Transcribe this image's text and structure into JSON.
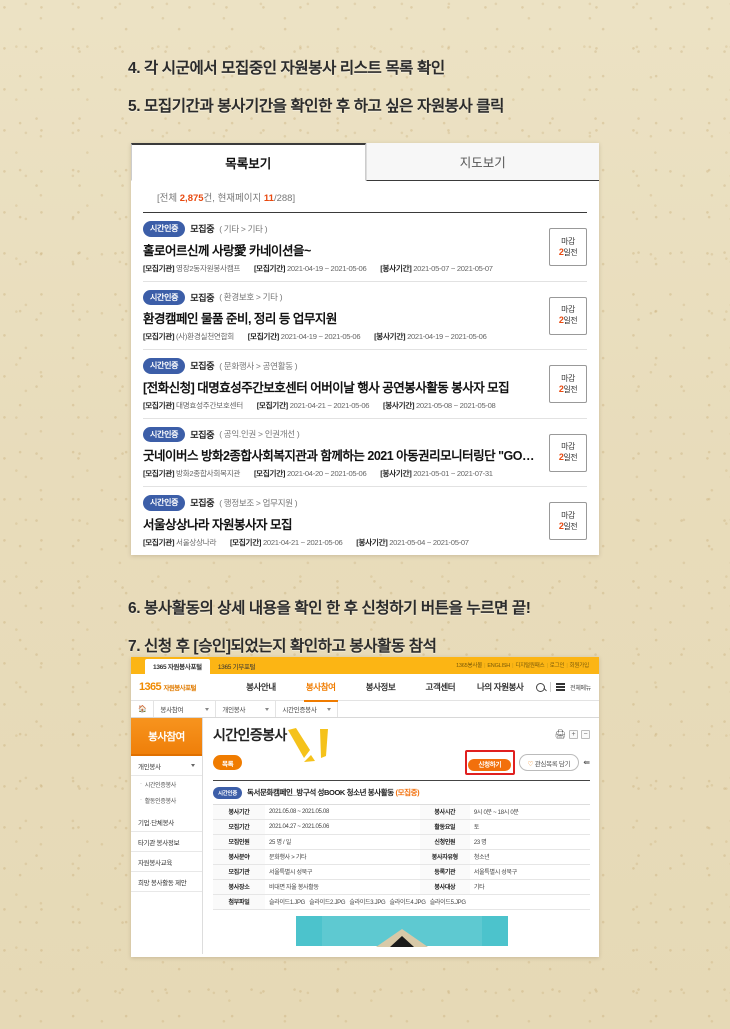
{
  "steps_top": [
    "4. 각 시군에서 모집중인 자원봉사 리스트 목록 확인",
    "5. 모집기간과 봉사기간을 확인한 후 하고 싶은 자원봉사 클릭"
  ],
  "steps_bottom": [
    "6. 봉사활동의 상세 내용을 확인 한 후 신청하기 버튼을 누르면 끝!",
    "7. 신청 후 [승인]되었는지 확인하고 봉사활동 참석"
  ],
  "list_panel": {
    "tabs": [
      {
        "label": "목록보기",
        "active": true
      },
      {
        "label": "지도보기",
        "active": false
      }
    ],
    "count": {
      "prefix": "[전체 ",
      "total": "2,875",
      "mid": "건, 현재페이지 ",
      "page": "11",
      "suffix": "/288]"
    },
    "labels": {
      "org": "[모집기관]",
      "recruit_period": "[모집기간]",
      "service_period": "[봉사기간]",
      "dday_label": "마감",
      "dday_unit": "일전",
      "cert_badge": "시간인증"
    },
    "items": [
      {
        "badge": "시간인증",
        "status": "모집중",
        "category": "( 기타  > 기타 )",
        "title": "홀로어르신께 사랑愛 카네이션을~",
        "org": "영장2동자원봉사캠프",
        "recruit_period": "2021-04-19 ~ 2021-05-06",
        "service_period": "2021-05-07 ~ 2021-05-07",
        "dday_num": "2"
      },
      {
        "badge": "시간인증",
        "status": "모집중",
        "category": "( 환경보호  > 기타 )",
        "title": "환경캠페인 물품 준비, 정리 등 업무지원",
        "org": "(사)환경실천연합회",
        "recruit_period": "2021-04-19 ~ 2021-05-06",
        "service_period": "2021-04-19 ~ 2021-05-06",
        "dday_num": "2"
      },
      {
        "badge": "시간인증",
        "status": "모집중",
        "category": "( 문화행사  > 공연활동 )",
        "title": "[전화신청] 대명효성주간보호센터 어버이날 행사 공연봉사활동 봉사자 모집",
        "org": "대명효성주간보호센터",
        "recruit_period": "2021-04-21 ~ 2021-05-06",
        "service_period": "2021-05-08 ~ 2021-05-08",
        "dday_num": "2"
      },
      {
        "badge": "시간인증",
        "status": "모집중",
        "category": "( 공익.인권  > 인권개선 )",
        "title": "굿네이버스 방화2종합사회복지관과 함께하는 2021 아동권리모니터링단 \"GOOD MOTI…",
        "org": "방화2종합사회복지관",
        "recruit_period": "2021-04-20 ~ 2021-05-06",
        "service_period": "2021-05-01 ~ 2021-07-31",
        "dday_num": "2"
      },
      {
        "badge": "시간인증",
        "status": "모집중",
        "category": "( 행정보조  > 업무지원 )",
        "title": "서울상상나라 자원봉사자 모집",
        "org": "서울상상나라",
        "recruit_period": "2021-04-21 ~ 2021-05-06",
        "service_period": "2021-05-04 ~ 2021-05-07",
        "dday_num": "2"
      }
    ]
  },
  "detail_panel": {
    "top_bar": {
      "tabs": [
        {
          "label": "1365 자원봉사포털",
          "active": true
        },
        {
          "label": "1365 기부포털",
          "active": false
        }
      ],
      "links": [
        "1365봉사몰",
        "ENGLISH",
        "디지털원패스",
        "로그인",
        "회원가입"
      ]
    },
    "gnb": {
      "logo": "1365",
      "logo_sub": "자원봉사포털",
      "items": [
        {
          "label": "봉사안내",
          "active": false
        },
        {
          "label": "봉사참여",
          "active": true
        },
        {
          "label": "봉사정보",
          "active": false
        },
        {
          "label": "고객센터",
          "active": false
        },
        {
          "label": "나의 자원봉사",
          "active": false
        }
      ],
      "menu_label": "전체메뉴"
    },
    "breadcrumb": [
      "봉사참여",
      "개인봉사",
      "시간인증봉사"
    ],
    "sidebar": {
      "title": "봉사참여",
      "group": "개인봉사",
      "subitems": [
        "시간인증봉사",
        "활동인증봉사"
      ],
      "items": [
        "기업·단체봉사",
        "타기관 봉사정보",
        "자원봉사교육",
        "희망 봉사활동 제안"
      ]
    },
    "content": {
      "title": "시간인증봉사",
      "list_button": "목록",
      "apply_button": "신청하기",
      "fav_button": "관심목록 담기",
      "zoom_in": "+",
      "zoom_out": "−",
      "detail_badge": "시간인증",
      "detail_title": "독서문화캠페인_방구석 성BOOK 청소년 봉사활동",
      "detail_status": "(모집중)",
      "table": [
        {
          "k1": "봉사기간",
          "v1": "2021.05.08 ~ 2021.05.08",
          "k2": "봉사시간",
          "v2": "9시 0분 ~ 18시 0분"
        },
        {
          "k1": "모집기간",
          "v1": "2021.04.27 ~ 2021.05.06",
          "k2": "활동요일",
          "v2": "토"
        },
        {
          "k1": "모집인원",
          "v1": "25 명 / 일",
          "k2": "신청인원",
          "v2": "23 명"
        },
        {
          "k1": "봉사분야",
          "v1": "문화행사 > 기타",
          "k2": "봉사자유형",
          "v2": "청소년"
        },
        {
          "k1": "모집기관",
          "v1": "서울특별시 성북구",
          "k2": "등록기관",
          "v2": "서울특별시 성북구"
        },
        {
          "k1": "봉사장소",
          "v1": "비대면 자율 봉사활동",
          "k2": "봉사대상",
          "v2": "기타"
        }
      ],
      "attach_label": "첨부파일",
      "attachments": [
        "슬라이드1.JPG",
        "슬라이드2.JPG",
        "슬라이드3.JPG",
        "슬라이드4.JPG",
        "슬라이드5.JPG"
      ]
    }
  },
  "colors": {
    "background": "#e8dcbb",
    "brand_orange": "#f07c00",
    "badge_blue": "#3c5ea8",
    "accent_red": "#e8490f",
    "highlight_box": "#e02020",
    "top_bar_yellow": "#fcb514",
    "teal": "#4cc3cc"
  }
}
